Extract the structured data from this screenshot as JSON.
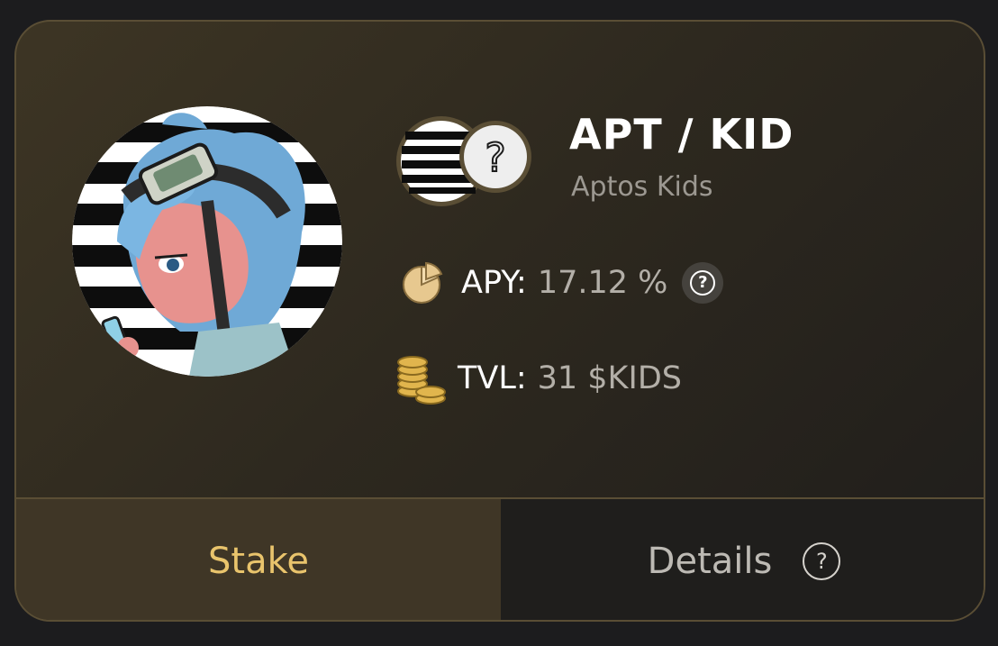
{
  "pool": {
    "title": "APT / KID",
    "subtitle": "Aptos Kids",
    "token_a_icon": "aptos-logo-icon",
    "token_b_icon": "unknown-token-question-icon",
    "avatar": "aptos-kid-nft-avatar"
  },
  "stats": {
    "apy": {
      "icon": "pie-chart-icon",
      "label": "APY:",
      "value": "17.12 %",
      "help_icon": "help-icon",
      "help_glyph": "?"
    },
    "tvl": {
      "icon": "coin-stack-icon",
      "label": "TVL:",
      "value": "31 $KIDS"
    }
  },
  "actions": {
    "stake_label": "Stake",
    "details_label": "Details",
    "details_help_glyph": "?"
  },
  "colors": {
    "accent_gold": "#e9c46c",
    "card_border": "#5a4e35",
    "stake_tab_bg": "#3f3626",
    "details_tab_bg": "#1f1e1c"
  }
}
